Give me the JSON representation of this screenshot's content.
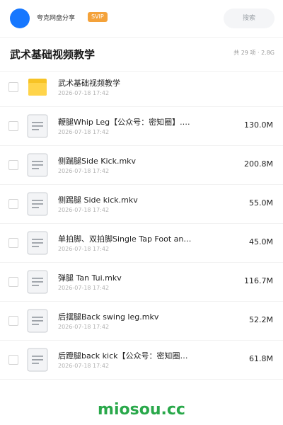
{
  "header": {
    "user_name": "夸克网盘分享",
    "badge": "SVIP",
    "search_label": "搜索"
  },
  "page": {
    "title": "武术基础视频教学",
    "summary": "共 29 项 · 2.8G"
  },
  "files": [
    {
      "name": "武术基础视频教学",
      "date": "2026-07-18 17:42",
      "size": "",
      "type": "folder-icon"
    },
    {
      "name": "鞭腿Whip Leg【公众号：密知圈】.mkv",
      "date": "2026-07-18 17:42",
      "size": "130.0M",
      "type": "file-icon"
    },
    {
      "name": "侧踹腿Side Kick.mkv",
      "date": "2026-07-18 17:42",
      "size": "200.8M",
      "type": "file-icon"
    },
    {
      "name": "侧踢腿 Side kick.mkv",
      "date": "2026-07-18 17:42",
      "size": "55.0M",
      "type": "file-icon"
    },
    {
      "name": "单拍脚、双拍脚Single Tap Foot an…",
      "date": "2026-07-18 17:42",
      "size": "45.0M",
      "type": "file-icon"
    },
    {
      "name": "弹腿 Tan Tui.mkv",
      "date": "2026-07-18 17:42",
      "size": "116.7M",
      "type": "file-icon"
    },
    {
      "name": "后摆腿Back swing leg.mkv",
      "date": "2026-07-18 17:42",
      "size": "52.2M",
      "type": "file-icon"
    },
    {
      "name": "后蹬腿back kick【公众号：密知圈】.mkv",
      "date": "2026-07-18 17:42",
      "size": "61.8M",
      "type": "file-icon"
    }
  ],
  "watermark": "miosou.cc",
  "colors": {
    "accent": "#1677ff",
    "svip": "#f4a23a",
    "folder": "#f7c325",
    "watermark": "#29a84a"
  }
}
